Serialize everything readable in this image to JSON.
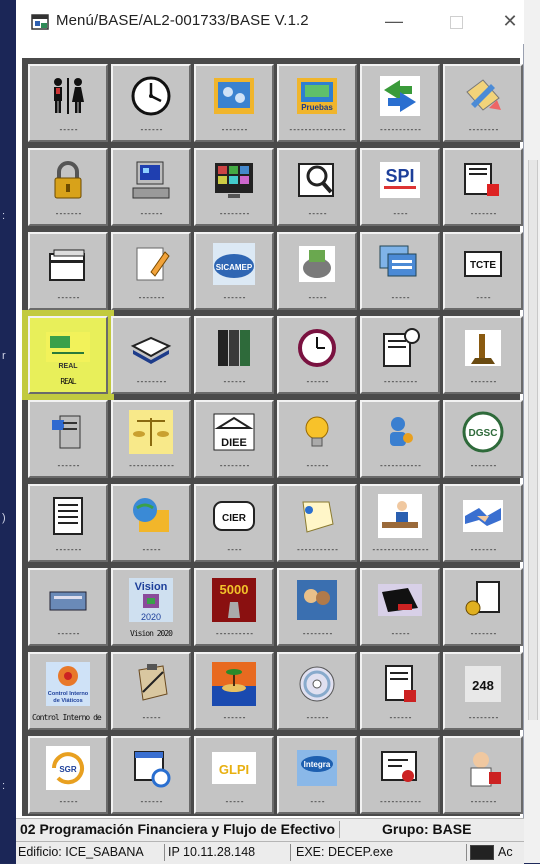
{
  "window": {
    "title": "Menú/BASE/AL2-001733/BASE V.1.2",
    "min_symbol": "—",
    "close_symbol": "✕"
  },
  "tiles": [
    {
      "caption": "-----",
      "icon": "restroom-people-icon"
    },
    {
      "caption": "------",
      "icon": "clock-icon"
    },
    {
      "caption": "-------",
      "icon": "gears-folder-icon"
    },
    {
      "caption": "---------------",
      "icon": "pruebas-app-icon"
    },
    {
      "caption": "-----------",
      "icon": "sync-arrows-icon"
    },
    {
      "caption": "--------",
      "icon": "tools-pencil-icon"
    },
    {
      "caption": "-------",
      "icon": "padlock-icon"
    },
    {
      "caption": "------",
      "icon": "computer-icon"
    },
    {
      "caption": "--------",
      "icon": "monitor-grid-icon"
    },
    {
      "caption": "-----",
      "icon": "document-search-icon"
    },
    {
      "caption": "----",
      "icon": "spi-logo-icon"
    },
    {
      "caption": "-------",
      "icon": "book-red-icon"
    },
    {
      "caption": "------",
      "icon": "folders-icon"
    },
    {
      "caption": "-------",
      "icon": "note-pencil-icon"
    },
    {
      "caption": "------",
      "icon": "sicamep-logo-icon"
    },
    {
      "caption": "-----",
      "icon": "hand-money-icon"
    },
    {
      "caption": "-----",
      "icon": "windows-stack-icon"
    },
    {
      "caption": "----",
      "icon": "tcte-box-icon"
    },
    {
      "caption": "REAL",
      "icon": "dgscp-real-icon"
    },
    {
      "caption": "--------",
      "icon": "open-book-icon"
    },
    {
      "caption": "------",
      "icon": "binders-icon"
    },
    {
      "caption": "------",
      "icon": "wall-clock-icon"
    },
    {
      "caption": "---------",
      "icon": "schedule-book-icon"
    },
    {
      "caption": "-------",
      "icon": "justice-statue-icon"
    },
    {
      "caption": "------",
      "icon": "server-phone-icon"
    },
    {
      "caption": "------------",
      "icon": "scales-icon"
    },
    {
      "caption": "--------",
      "icon": "diee-building-icon"
    },
    {
      "caption": "------",
      "icon": "lightbulb-icon"
    },
    {
      "caption": "-----------",
      "icon": "key-user-icon"
    },
    {
      "caption": "-------",
      "icon": "dgsc-seal-icon"
    },
    {
      "caption": "-------",
      "icon": "document-list-icon"
    },
    {
      "caption": "-----",
      "icon": "globe-folder-icon"
    },
    {
      "caption": "----",
      "icon": "cier-logo-icon"
    },
    {
      "caption": "-----------",
      "icon": "note-pin-icon"
    },
    {
      "caption": "---------------",
      "icon": "office-worker-icon"
    },
    {
      "caption": "-------",
      "icon": "handshake-icon"
    },
    {
      "caption": "------",
      "icon": "card-reader-icon"
    },
    {
      "caption": "Vision 2020",
      "icon": "vision-2020-icon"
    },
    {
      "caption": "----------",
      "icon": "5000-chess-icon"
    },
    {
      "caption": "--------",
      "icon": "people-photo-icon"
    },
    {
      "caption": "-----",
      "icon": "laptop-card-icon"
    },
    {
      "caption": "-------",
      "icon": "key-cards-icon"
    },
    {
      "caption": "Control Interno de Viáticos",
      "icon": "control-interno-icon"
    },
    {
      "caption": "-----",
      "icon": "clipboard-pen-icon"
    },
    {
      "caption": "------",
      "icon": "island-sunset-icon"
    },
    {
      "caption": "------",
      "icon": "cd-disc-icon"
    },
    {
      "caption": "------",
      "icon": "invoice-icon"
    },
    {
      "caption": "--------",
      "icon": "numbers-248-icon"
    },
    {
      "caption": "-----",
      "icon": "sgr-logo-icon"
    },
    {
      "caption": "------",
      "icon": "calendar-refresh-icon"
    },
    {
      "caption": "-----",
      "icon": "glpi-logo-icon"
    },
    {
      "caption": "----",
      "icon": "integra-icon"
    },
    {
      "caption": "-----------",
      "icon": "certificate-icon"
    },
    {
      "caption": "-------",
      "icon": "doctor-icon"
    }
  ],
  "status": {
    "programa": "02 Programación Financiera y Flujo de Efectivo",
    "grupo": "Grupo: BASE",
    "edificio": "Edificio: ICE_SABANA",
    "ip": "IP 10.11.28.148",
    "exe": "EXE: DECEP.exe",
    "extra": "Ac"
  },
  "labels": {
    "real": "REAL",
    "vision": "Vision",
    "vision_year": "2020",
    "ci_line1": "Control Interno",
    "ci_line2": "de Viáticos",
    "sicamep": "SICAMEP",
    "diee": "DIEE",
    "dgsc": "DGSC",
    "cier": "CIER",
    "sgr": "SGR",
    "glpi": "GLPI",
    "integra": "Integra",
    "tcte": "TCTE",
    "n5000": "5000",
    "spi": "SPI",
    "pruebas": "Pruebas",
    "num248": "248"
  }
}
